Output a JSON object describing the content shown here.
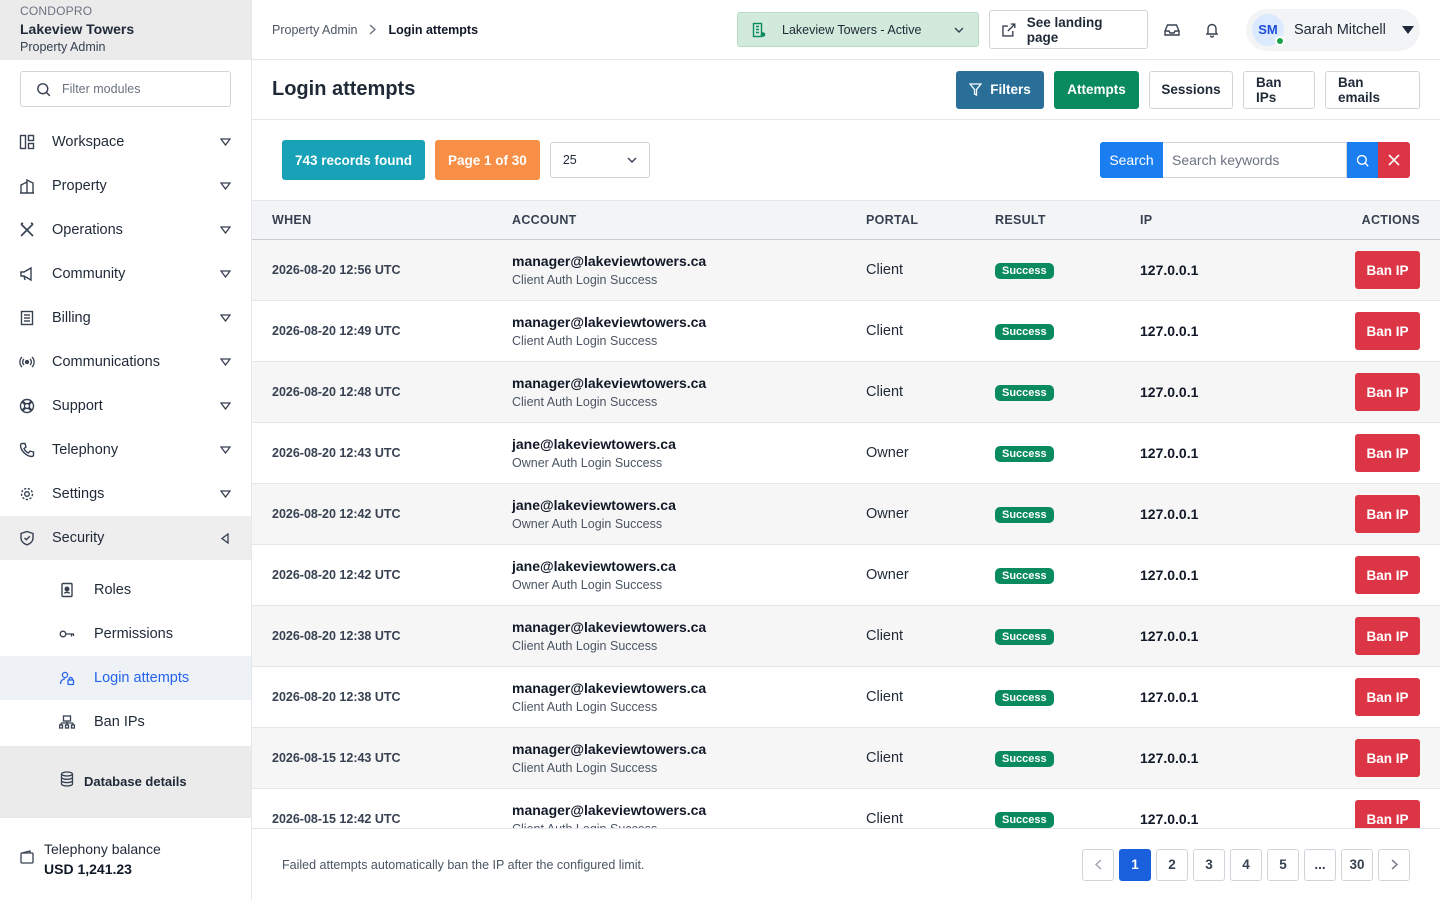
{
  "brand": {
    "app": "CONDOPRO",
    "property": "Lakeview Towers",
    "role": "Property Admin"
  },
  "sidebar": {
    "filter_placeholder": "Filter modules",
    "items": [
      {
        "label": "Workspace",
        "icon": "workspace-icon"
      },
      {
        "label": "Property",
        "icon": "building-icon"
      },
      {
        "label": "Operations",
        "icon": "tools-icon"
      },
      {
        "label": "Community",
        "icon": "megaphone-icon"
      },
      {
        "label": "Billing",
        "icon": "invoice-icon"
      },
      {
        "label": "Communications",
        "icon": "broadcast-icon"
      },
      {
        "label": "Support",
        "icon": "lifebuoy-icon"
      },
      {
        "label": "Telephony",
        "icon": "phone-icon"
      },
      {
        "label": "Settings",
        "icon": "gear-icon"
      },
      {
        "label": "Security",
        "icon": "shield-icon"
      }
    ],
    "security_sub": [
      {
        "label": "Roles",
        "icon": "id-badge-icon"
      },
      {
        "label": "Permissions",
        "icon": "key-icon"
      },
      {
        "label": "Login attempts",
        "icon": "user-lock-icon"
      },
      {
        "label": "Ban IPs",
        "icon": "network-icon"
      }
    ],
    "database": "Database details",
    "balance_label": "Telephony balance",
    "balance_value": "USD 1,241.23"
  },
  "breadcrumb": {
    "parent": "Property Admin",
    "current": "Login attempts"
  },
  "topbar": {
    "property_select": "Lakeview Towers - Active",
    "landing_label": "See landing page",
    "user_initials": "SM",
    "user_name": "Sarah Mitchell"
  },
  "page": {
    "title": "Login attempts",
    "buttons": {
      "filters": "Filters",
      "attempts": "Attempts",
      "sessions": "Sessions",
      "ban_ips": "Ban IPs",
      "ban_emails": "Ban emails"
    }
  },
  "toolbar": {
    "records": "743 records found",
    "page_info": "Page 1 of 30",
    "per_page": "25",
    "search_label": "Search",
    "search_placeholder": "Search keywords"
  },
  "table": {
    "headers": {
      "when": "WHEN",
      "account": "ACCOUNT",
      "portal": "PORTAL",
      "result": "RESULT",
      "ip": "IP",
      "actions": "ACTIONS"
    },
    "action_label": "Ban IP",
    "rows": [
      {
        "when": "2026-08-20 12:56 UTC",
        "email": "manager@lakeviewtowers.ca",
        "desc": "Client Auth Login Success",
        "portal": "Client",
        "result": "Success",
        "ip": "127.0.0.1"
      },
      {
        "when": "2026-08-20 12:49 UTC",
        "email": "manager@lakeviewtowers.ca",
        "desc": "Client Auth Login Success",
        "portal": "Client",
        "result": "Success",
        "ip": "127.0.0.1"
      },
      {
        "when": "2026-08-20 12:48 UTC",
        "email": "manager@lakeviewtowers.ca",
        "desc": "Client Auth Login Success",
        "portal": "Client",
        "result": "Success",
        "ip": "127.0.0.1"
      },
      {
        "when": "2026-08-20 12:43 UTC",
        "email": "jane@lakeviewtowers.ca",
        "desc": "Owner Auth Login Success",
        "portal": "Owner",
        "result": "Success",
        "ip": "127.0.0.1"
      },
      {
        "when": "2026-08-20 12:42 UTC",
        "email": "jane@lakeviewtowers.ca",
        "desc": "Owner Auth Login Success",
        "portal": "Owner",
        "result": "Success",
        "ip": "127.0.0.1"
      },
      {
        "when": "2026-08-20 12:42 UTC",
        "email": "jane@lakeviewtowers.ca",
        "desc": "Owner Auth Login Success",
        "portal": "Owner",
        "result": "Success",
        "ip": "127.0.0.1"
      },
      {
        "when": "2026-08-20 12:38 UTC",
        "email": "manager@lakeviewtowers.ca",
        "desc": "Client Auth Login Success",
        "portal": "Client",
        "result": "Success",
        "ip": "127.0.0.1"
      },
      {
        "when": "2026-08-20 12:38 UTC",
        "email": "manager@lakeviewtowers.ca",
        "desc": "Client Auth Login Success",
        "portal": "Client",
        "result": "Success",
        "ip": "127.0.0.1"
      },
      {
        "when": "2026-08-15 12:43 UTC",
        "email": "manager@lakeviewtowers.ca",
        "desc": "Client Auth Login Success",
        "portal": "Client",
        "result": "Success",
        "ip": "127.0.0.1"
      },
      {
        "when": "2026-08-15 12:42 UTC",
        "email": "manager@lakeviewtowers.ca",
        "desc": "Client Auth Login Success",
        "portal": "Client",
        "result": "Success",
        "ip": "127.0.0.1"
      }
    ]
  },
  "footer": {
    "note": "Failed attempts automatically ban the IP after the configured limit.",
    "pages": [
      "1",
      "2",
      "3",
      "4",
      "5",
      "...",
      "30"
    ],
    "current_page": "1"
  },
  "colors": {
    "success": "#0a8a5f",
    "danger": "#dc3545",
    "primary": "#1a7ef0",
    "info": "#17a2b8",
    "warning": "#f78f47"
  }
}
